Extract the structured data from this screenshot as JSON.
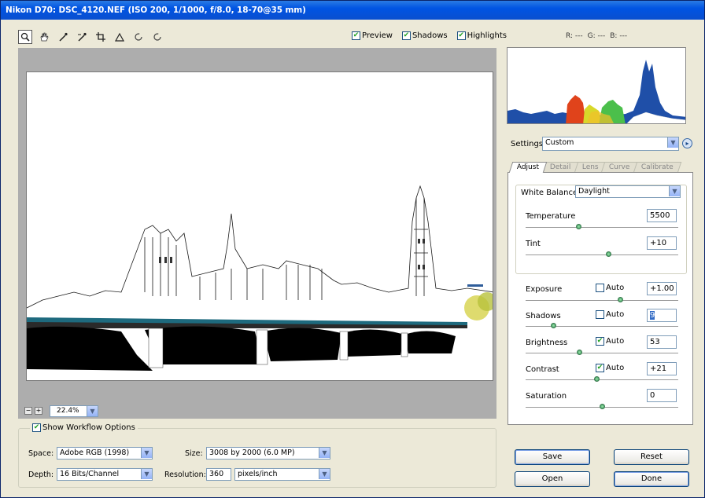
{
  "window": {
    "title": "Nikon D70: DSC_4120.NEF  (ISO 200, 1/1000, f/8.0, 18-70@35 mm)"
  },
  "toolbar": {
    "tools": [
      {
        "name": "zoom-tool-icon",
        "glyph": "🔍"
      },
      {
        "name": "hand-tool-icon",
        "glyph": "✋"
      },
      {
        "name": "white-balance-tool-icon",
        "glyph": "⟋"
      },
      {
        "name": "color-sampler-tool-icon",
        "glyph": "⟋"
      },
      {
        "name": "crop-tool-icon",
        "glyph": "⌗"
      },
      {
        "name": "straighten-tool-icon",
        "glyph": "△"
      },
      {
        "name": "rotate-left-icon",
        "glyph": "↺"
      },
      {
        "name": "rotate-right-icon",
        "glyph": "↻"
      }
    ],
    "checkboxes": [
      {
        "label": "Preview",
        "checked": true
      },
      {
        "label": "Shadows",
        "checked": true
      },
      {
        "label": "Highlights",
        "checked": true
      }
    ],
    "rgb": {
      "r": "R: ---",
      "g": "G: ---",
      "b": "B: ---"
    }
  },
  "zoom": {
    "value": "22.4%"
  },
  "workflow": {
    "title": "Show Workflow Options",
    "space_label": "Space:",
    "space_value": "Adobe RGB (1998)",
    "depth_label": "Depth:",
    "depth_value": "16 Bits/Channel",
    "size_label": "Size:",
    "size_value": "3008 by 2000 (6.0 MP)",
    "resolution_label": "Resolution:",
    "resolution_value": "360",
    "resolution_unit": "pixels/inch"
  },
  "settings": {
    "label": "Settings:",
    "value": "Custom"
  },
  "tabs": [
    "Adjust",
    "Detail",
    "Lens",
    "Curve",
    "Calibrate"
  ],
  "adjust": {
    "white_balance_label": "White Balance:",
    "white_balance_value": "Daylight",
    "temperature_label": "Temperature",
    "temperature_value": "5500",
    "tint_label": "Tint",
    "tint_value": "+10",
    "exposure_label": "Exposure",
    "exposure_value": "+1.00",
    "exposure_auto": false,
    "shadows_label": "Shadows",
    "shadows_value": "9",
    "shadows_auto": false,
    "brightness_label": "Brightness",
    "brightness_value": "53",
    "brightness_auto": true,
    "contrast_label": "Contrast",
    "contrast_value": "+21",
    "contrast_auto": true,
    "saturation_label": "Saturation",
    "saturation_value": "0",
    "auto_label": "Auto"
  },
  "buttons": {
    "save": "Save",
    "open": "Open",
    "reset": "Reset",
    "done": "Done"
  },
  "colors": {
    "titlebar": "#0054E3",
    "check": "#21A121",
    "selection": "#316AC5"
  }
}
